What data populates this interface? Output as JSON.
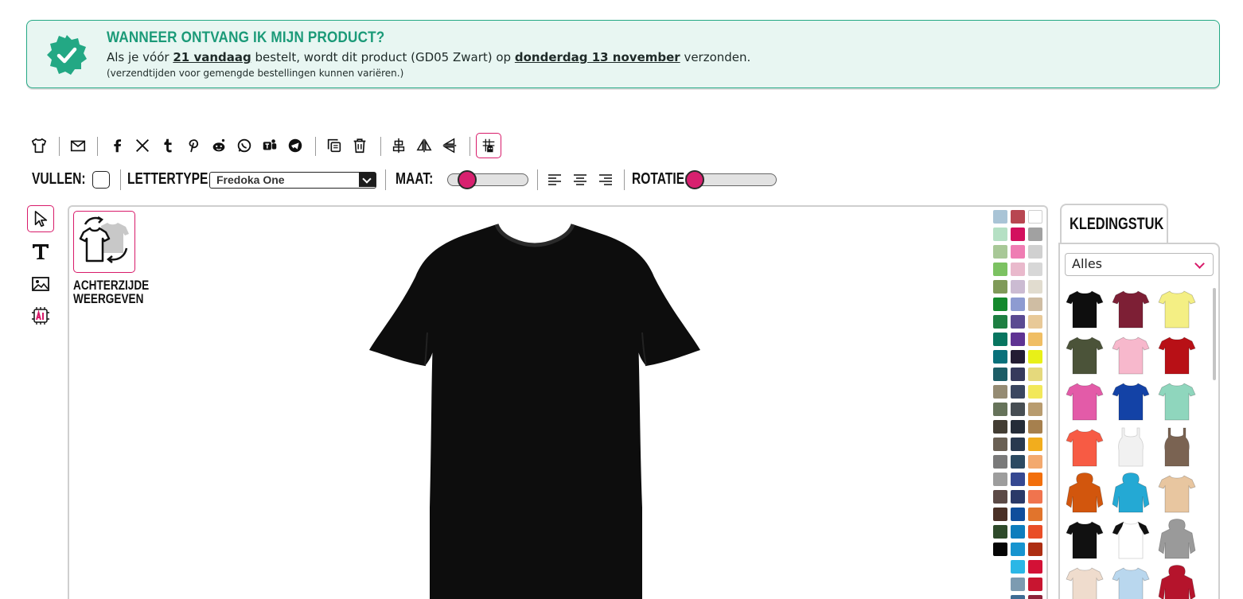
{
  "banner": {
    "title": "WANNEER ONTVANG IK MIJN PRODUCT?",
    "msg_prefix": "Als je vóór ",
    "time_link": "21 vandaag",
    "msg_middle": " bestelt, wordt dit product (GD05 Zwart) op ",
    "date_link": "donderdag 13 november",
    "msg_suffix": " verzonden.",
    "note": "(verzendtijden voor gemengde bestellingen kunnen variëren.)",
    "accent_color": "#23a884"
  },
  "toolbar": {
    "icons": [
      "tshirt-icon",
      "email-icon",
      "facebook-icon",
      "x-icon",
      "tumblr-icon",
      "pinterest-icon",
      "reddit-icon",
      "whatsapp-icon",
      "teams-icon",
      "telegram-icon",
      "copy-icon",
      "trash-icon",
      "align-center-icon",
      "flip-horizontal-icon",
      "flip-vertical-icon",
      "grid-snap-icon"
    ],
    "active": "grid-snap-icon"
  },
  "format_bar": {
    "fill_label": "VULLEN:",
    "font_label": "LETTERTYPE:",
    "font_value": "Fredoka One",
    "size_label": "MAAT:",
    "size_level": 0.22,
    "rotation_label": "ROTATIE:",
    "rotation_level": 0.0,
    "align_icons": [
      "align-left-icon",
      "align-center-icon",
      "align-right-icon"
    ]
  },
  "tools": [
    {
      "name": "select-tool",
      "icon": "cursor-icon",
      "active": true
    },
    {
      "name": "text-tool",
      "icon": "text-icon",
      "active": false
    },
    {
      "name": "image-tool",
      "icon": "image-icon",
      "active": false
    },
    {
      "name": "ai-tool",
      "icon": "ai-chip-icon",
      "active": false
    }
  ],
  "canvas": {
    "back_button_label_1": "ACHTERZIJDE",
    "back_button_label_2": "WEERGEVEN",
    "product_color": "#0d0d0d"
  },
  "palette": {
    "columns": [
      [
        "#a9c4d6",
        "#b5e0c4",
        "#a8c897",
        "#7cc262",
        "#7f9a58",
        "#14892c",
        "#1e7f42",
        "#087560",
        "#08707a",
        "#1d5d66",
        "#958b73",
        "#66735a",
        "#433d33",
        "#6a6054",
        "#7a7a7a",
        "#9d9d9d",
        "#5c4a46",
        "#4a3026",
        "#2e4a2a",
        "#050505"
      ],
      [
        "#b84651",
        "#d3105e",
        "#ef7db3",
        "#e9b9cc",
        "#cbbbd2",
        "#8d9bd1",
        "#5a4a92",
        "#5f3393",
        "#231c33",
        "#363a5c",
        "#3a4660",
        "#474e53",
        "#242c38",
        "#29394f",
        "#2c4a62",
        "#364891",
        "#2a3968",
        "#0f4e9c",
        "#0d7dbd",
        "#1794cf",
        "#2bb7e6",
        "#7c9bb1",
        "#3e6c94"
      ],
      [
        "#ffffff",
        "#a1a1a1",
        "#d0d0d0",
        "#d7d7d7",
        "#e1dccf",
        "#cfbda3",
        "#e8c998",
        "#f0be64",
        "#e8f018",
        "#e5d97c",
        "#f2e85a",
        "#b89c6f",
        "#a6804e",
        "#f2ad1d",
        "#f3a96e",
        "#f26f0c",
        "#f0744e",
        "#e1742c",
        "#e94e27",
        "#ad2e13",
        "#d31136",
        "#c81530",
        "#8e2238"
      ]
    ]
  },
  "garment_panel": {
    "tab_label": "KLEDINGSTUK",
    "category_value": "Alles",
    "items": [
      {
        "name": "black-tshirt",
        "color": "#0e0e0e",
        "kind": "tee"
      },
      {
        "name": "maroon-tshirt",
        "color": "#7d1f35",
        "kind": "tee"
      },
      {
        "name": "yellow-tshirt",
        "color": "#f4ef84",
        "kind": "tee"
      },
      {
        "name": "olive-tshirt",
        "color": "#4b5339",
        "kind": "tee"
      },
      {
        "name": "pink-tshirt",
        "color": "#f7b8cc",
        "kind": "tee"
      },
      {
        "name": "red-tshirt",
        "color": "#b81016",
        "kind": "tee"
      },
      {
        "name": "magenta-tshirt",
        "color": "#e35ba8",
        "kind": "tee"
      },
      {
        "name": "royal-blue-tshirt",
        "color": "#1342a6",
        "kind": "tee"
      },
      {
        "name": "mint-tshirt",
        "color": "#8fd6bd",
        "kind": "tee"
      },
      {
        "name": "coral-tshirt",
        "color": "#f75b44",
        "kind": "tee"
      },
      {
        "name": "white-tank",
        "color": "#f1f1f1",
        "kind": "tank"
      },
      {
        "name": "brown-tank",
        "color": "#7a6352",
        "kind": "tank"
      },
      {
        "name": "orange-hoodie",
        "color": "#d2560d",
        "kind": "hoodie"
      },
      {
        "name": "turquoise-hoodie",
        "color": "#24a9d4",
        "kind": "hoodie"
      },
      {
        "name": "tie-dye-tshirt",
        "color": "#e8c6a0",
        "kind": "tee"
      },
      {
        "name": "black-ringer-tshirt",
        "color": "#111111",
        "kind": "tee"
      },
      {
        "name": "raglan-tshirt",
        "color": "#ffffff",
        "kind": "raglan"
      },
      {
        "name": "grey-hoodie",
        "color": "#9a9a9a",
        "kind": "hoodie"
      },
      {
        "name": "sand-tshirt",
        "color": "#efdccd",
        "kind": "tee"
      },
      {
        "name": "light-blue-tshirt",
        "color": "#b9d7ee",
        "kind": "tee"
      },
      {
        "name": "red-varsity-jacket",
        "color": "#b5142c",
        "kind": "hoodie"
      }
    ]
  }
}
